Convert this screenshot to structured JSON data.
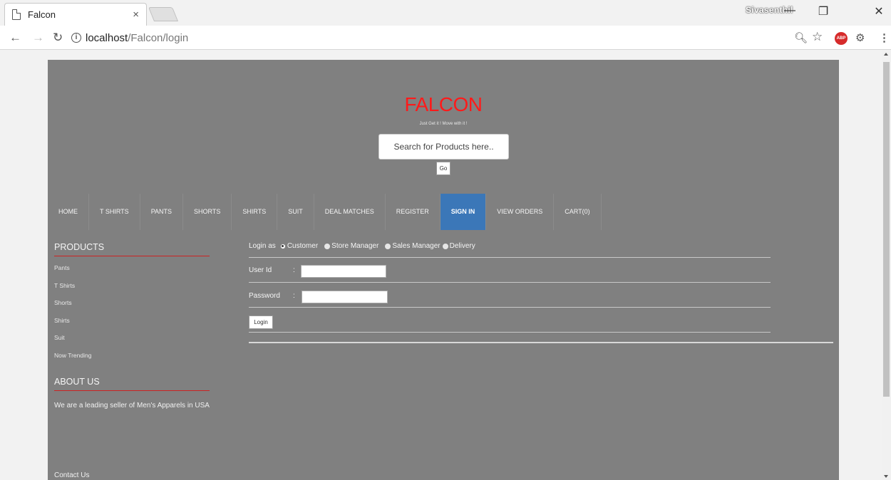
{
  "browser": {
    "tab_title": "Falcon",
    "tab_close": "×",
    "user_name": "Sivasenthil",
    "url_host": "localhost",
    "url_path": "/Falcon/login",
    "win_minimize": "—",
    "win_restore": "❐",
    "win_close": "✕"
  },
  "site": {
    "brand": "FALCON",
    "tagline": "Just Get it ! Move with it !",
    "search_placeholder": "Search for Products here..",
    "go_label": "Go",
    "nav": [
      "HOME",
      "T SHIRTS",
      "PANTS",
      "SHORTS",
      "SHIRTS",
      "SUIT",
      "DEAL MATCHES",
      "REGISTER",
      "SIGN IN",
      "VIEW ORDERS",
      "CART(0)"
    ],
    "active_nav": "SIGN IN",
    "accent_color": "#3b77b8",
    "brand_color": "#ff1a1a"
  },
  "sidebar": {
    "products_title": "PRODUCTS",
    "products": [
      "Pants",
      "T Shirts",
      "Shorts",
      "Shirts",
      "Suit",
      "Now Trending"
    ],
    "about_title": "ABOUT US",
    "about_text": "We are a leading seller of Men's Apparels in USA",
    "contact": "Contact Us"
  },
  "login": {
    "login_as_label": "Login as",
    "roles": [
      "Customer",
      "Store Manager",
      "Sales Manager",
      "Delivery"
    ],
    "selected_role": "Customer",
    "user_id_label": "User Id",
    "password_label": "Password",
    "colon": ":",
    "user_id_value": "",
    "password_value": "",
    "login_button": "Login"
  }
}
